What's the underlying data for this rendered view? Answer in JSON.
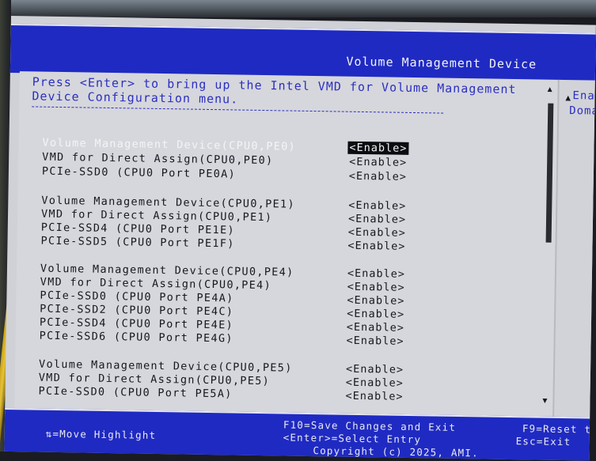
{
  "header": {
    "title": "Volume Management Device"
  },
  "help": {
    "text": "Press <Enter> to bring up the Intel VMD for Volume Management\nDevice Configuration menu.",
    "dashes": "---------------------------------------------------------"
  },
  "side_panel": {
    "line1": "Ena",
    "line2": "Doma"
  },
  "settings": [
    {
      "label": "Volume Management Device(CPU0,PE0)",
      "value": "<Enable>",
      "selected": true
    },
    {
      "label": "VMD for Direct Assign(CPU0,PE0)",
      "value": "<Enable>"
    },
    {
      "label": "PCIe-SSD0 (CPU0 Port PE0A)",
      "value": "<Enable>"
    },
    {
      "label": "Volume Management Device(CPU0,PE1)",
      "value": "<Enable>"
    },
    {
      "label": "VMD for Direct Assign(CPU0,PE1)",
      "value": "<Enable>"
    },
    {
      "label": "PCIe-SSD4 (CPU0 Port PE1E)",
      "value": "<Enable>"
    },
    {
      "label": "PCIe-SSD5 (CPU0 Port PE1F)",
      "value": "<Enable>"
    },
    {
      "label": "Volume Management Device(CPU0,PE4)",
      "value": "<Enable>"
    },
    {
      "label": "VMD for Direct Assign(CPU0,PE4)",
      "value": "<Enable>"
    },
    {
      "label": "PCIe-SSD0 (CPU0 Port PE4A)",
      "value": "<Enable>"
    },
    {
      "label": "PCIe-SSD2 (CPU0 Port PE4C)",
      "value": "<Enable>"
    },
    {
      "label": "PCIe-SSD4 (CPU0 Port PE4E)",
      "value": "<Enable>"
    },
    {
      "label": "PCIe-SSD6 (CPU0 Port PE4G)",
      "value": "<Enable>"
    },
    {
      "label": "Volume Management Device(CPU0,PE5)",
      "value": "<Enable>"
    },
    {
      "label": "VMD for Direct Assign(CPU0,PE5)",
      "value": "<Enable>"
    },
    {
      "label": "PCIe-SSD0 (CPU0 Port PE5A)",
      "value": "<Enable>"
    }
  ],
  "scrollbar": {
    "up_glyph": "▲",
    "down_glyph": "▼"
  },
  "footer": {
    "move": "⇅=Move Highlight",
    "save": "F10=Save Changes and Exit",
    "select": "<Enter>=Select Entry",
    "copyright": "Copyright (c) 2025, AMI.",
    "reset": "F9=Reset t",
    "exit": "Esc=Exit"
  },
  "colors": {
    "title_bar": "#1f2ac2",
    "help_text": "#2b2fc0",
    "panel_bg": "#d6d7dc"
  }
}
